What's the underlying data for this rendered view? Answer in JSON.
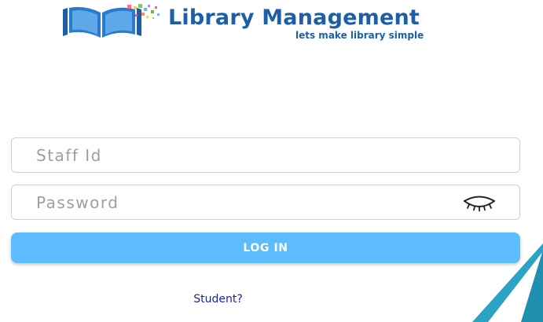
{
  "brand": {
    "title": "Library Management",
    "tagline": "lets make library simple",
    "logo_icon": "open-book-icon"
  },
  "login_form": {
    "staff_id": {
      "placeholder": "Staff Id",
      "value": ""
    },
    "password": {
      "placeholder": "Password",
      "value": "",
      "visibility_toggle_icon": "closed-eye-icon"
    },
    "login_button_label": "LOG IN",
    "student_link_label": "Student?"
  },
  "colors": {
    "brand_blue": "#1d5fa6",
    "button_blue": "#5cbcfd",
    "link_blue": "#1a23a6",
    "corner_teal": "#2aa3c4"
  }
}
